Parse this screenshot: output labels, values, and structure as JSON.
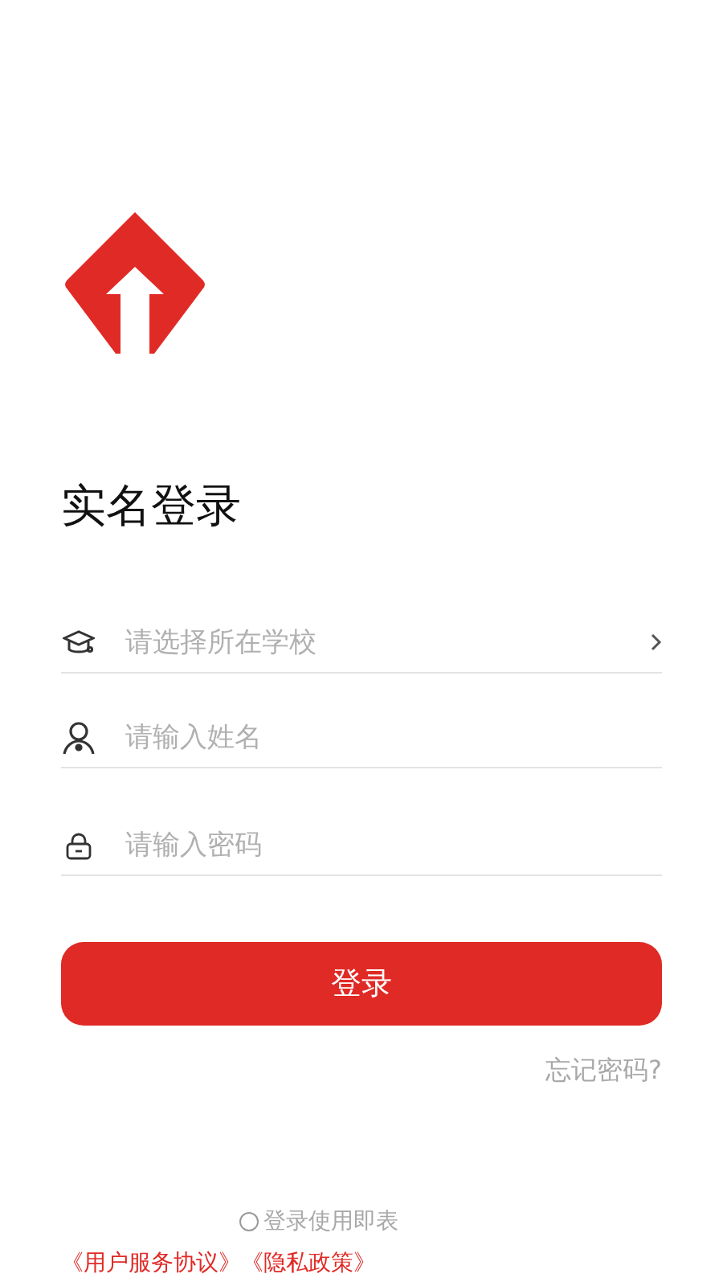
{
  "title": "实名登录",
  "fields": [
    {
      "kind": "select",
      "placeholder": "请选择所在学校"
    },
    {
      "kind": "name",
      "placeholder": "请输入姓名"
    },
    {
      "kind": "password",
      "placeholder": "请输入密码"
    }
  ],
  "login_button": "登录",
  "forgot_link": "忘记密码?",
  "consent": {
    "checked": false,
    "text": "登录使用即表"
  },
  "agreements": [
    "《用户服务协议》",
    "《隐私政策》"
  ]
}
